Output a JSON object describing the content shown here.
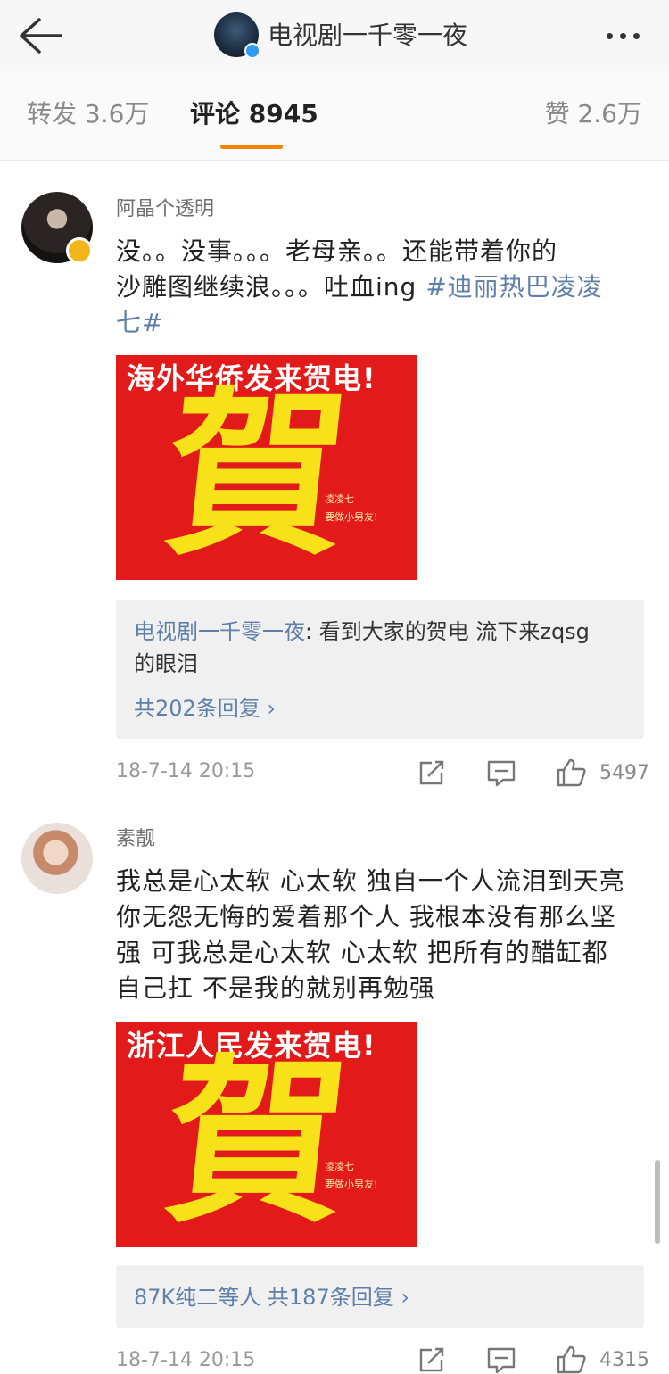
{
  "header": {
    "title": "电视剧一千零一夜"
  },
  "tabs": {
    "repost": "转发 3.6万",
    "comments": "评论 8945",
    "likes": "赞 2.6万"
  },
  "comments": [
    {
      "nickname": "阿晶个透明",
      "text_lines": [
        "没。。没事。。。老母亲。。还能带着你的",
        "沙雕图继续浪。。。吐血ing "
      ],
      "hashtag_part1": "#迪丽热巴凌凌",
      "hashtag_part2": "七#",
      "image_headline": "海外华侨发来贺电!",
      "image_char": "賀",
      "image_small_line1": "凌凌七",
      "image_small_line2": "要做小男友!",
      "reply_author": "电视剧一千零一夜",
      "reply_text_1": ": 看到大家的贺电 流下来zqsg",
      "reply_text_2": "的眼泪",
      "reply_more": "共202条回复 ›",
      "time": "18-7-14 20:15",
      "likes": "5497"
    },
    {
      "nickname": "素靓",
      "text_lines": [
        "我总是心太软 心太软 独自一个人流泪到天亮",
        "你无怨无悔的爱着那个人 我根本没有那么坚",
        "强 可我总是心太软 心太软 把所有的醋缸都",
        "自己扛 不是我的就别再勉强"
      ],
      "image_headline": "浙江人民发来贺电!",
      "image_char": "賀",
      "image_small_line1": "凌凌七",
      "image_small_line2": "要做小男友!",
      "reply_more": "87K纯二等人  共187条回复 ›",
      "time": "18-7-14 20:15",
      "likes": "4315"
    }
  ]
}
